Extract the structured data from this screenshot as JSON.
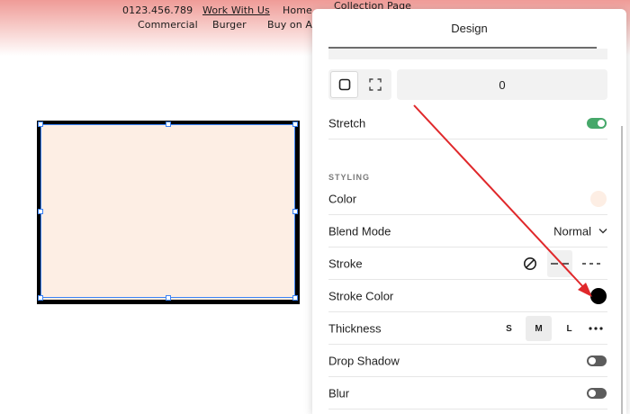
{
  "site": {
    "nav_row1": [
      "0123.456.789",
      "Work With Us",
      "Home",
      "Collection Page"
    ],
    "nav_row2": [
      "Commercial",
      "Burger",
      "Buy on Ama"
    ]
  },
  "panel": {
    "title": "Design",
    "value_field": "0",
    "stretch_label": "Stretch",
    "stretch_on": true,
    "section_title": "STYLING",
    "color_label": "Color",
    "fill_color": "#fdeee4",
    "blend_label": "Blend Mode",
    "blend_value": "Normal",
    "stroke_label": "Stroke",
    "stroke_color_label": "Stroke Color",
    "stroke_color": "#000000",
    "thickness_label": "Thickness",
    "thickness_options": [
      "S",
      "M",
      "L"
    ],
    "thickness_selected": "M",
    "drop_shadow_label": "Drop Shadow",
    "drop_shadow_on": false,
    "blur_label": "Blur",
    "blur_on": false
  },
  "colors": {
    "accent": "#3b82f6",
    "toggle_on": "#46a86a",
    "annotation_arrow": "#e0282b"
  }
}
